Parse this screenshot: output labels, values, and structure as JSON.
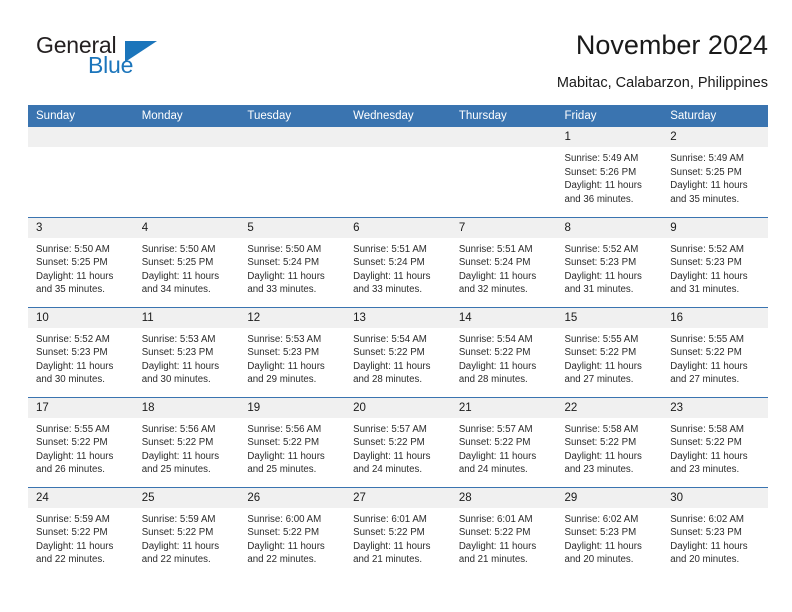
{
  "brand": {
    "name_top": "General",
    "name_bottom": "Blue",
    "triangle_icon": "blue-triangle-logo-mark",
    "color_top": "#231f20",
    "color_bottom": "#1b75bb"
  },
  "header": {
    "title": "November 2024",
    "subtitle": "Mabitac, Calabarzon, Philippines"
  },
  "theme": {
    "header_blue": "#3a74b0",
    "daynum_band": "#f0f0f0",
    "text": "#2b2b2b"
  },
  "weekday_headers": [
    "Sunday",
    "Monday",
    "Tuesday",
    "Wednesday",
    "Thursday",
    "Friday",
    "Saturday"
  ],
  "labels": {
    "sunrise_prefix": "Sunrise:",
    "sunset_prefix": "Sunset:",
    "daylight_prefix": "Daylight:"
  },
  "weeks": [
    [
      {
        "day": "",
        "empty": true
      },
      {
        "day": "",
        "empty": true
      },
      {
        "day": "",
        "empty": true
      },
      {
        "day": "",
        "empty": true
      },
      {
        "day": "",
        "empty": true
      },
      {
        "day": "1",
        "sunrise": "Sunrise: 5:49 AM",
        "sunset": "Sunset: 5:26 PM",
        "daylight_1": "Daylight: 11 hours",
        "daylight_2": "and 36 minutes."
      },
      {
        "day": "2",
        "sunrise": "Sunrise: 5:49 AM",
        "sunset": "Sunset: 5:25 PM",
        "daylight_1": "Daylight: 11 hours",
        "daylight_2": "and 35 minutes."
      }
    ],
    [
      {
        "day": "3",
        "sunrise": "Sunrise: 5:50 AM",
        "sunset": "Sunset: 5:25 PM",
        "daylight_1": "Daylight: 11 hours",
        "daylight_2": "and 35 minutes."
      },
      {
        "day": "4",
        "sunrise": "Sunrise: 5:50 AM",
        "sunset": "Sunset: 5:25 PM",
        "daylight_1": "Daylight: 11 hours",
        "daylight_2": "and 34 minutes."
      },
      {
        "day": "5",
        "sunrise": "Sunrise: 5:50 AM",
        "sunset": "Sunset: 5:24 PM",
        "daylight_1": "Daylight: 11 hours",
        "daylight_2": "and 33 minutes."
      },
      {
        "day": "6",
        "sunrise": "Sunrise: 5:51 AM",
        "sunset": "Sunset: 5:24 PM",
        "daylight_1": "Daylight: 11 hours",
        "daylight_2": "and 33 minutes."
      },
      {
        "day": "7",
        "sunrise": "Sunrise: 5:51 AM",
        "sunset": "Sunset: 5:24 PM",
        "daylight_1": "Daylight: 11 hours",
        "daylight_2": "and 32 minutes."
      },
      {
        "day": "8",
        "sunrise": "Sunrise: 5:52 AM",
        "sunset": "Sunset: 5:23 PM",
        "daylight_1": "Daylight: 11 hours",
        "daylight_2": "and 31 minutes."
      },
      {
        "day": "9",
        "sunrise": "Sunrise: 5:52 AM",
        "sunset": "Sunset: 5:23 PM",
        "daylight_1": "Daylight: 11 hours",
        "daylight_2": "and 31 minutes."
      }
    ],
    [
      {
        "day": "10",
        "sunrise": "Sunrise: 5:52 AM",
        "sunset": "Sunset: 5:23 PM",
        "daylight_1": "Daylight: 11 hours",
        "daylight_2": "and 30 minutes."
      },
      {
        "day": "11",
        "sunrise": "Sunrise: 5:53 AM",
        "sunset": "Sunset: 5:23 PM",
        "daylight_1": "Daylight: 11 hours",
        "daylight_2": "and 30 minutes."
      },
      {
        "day": "12",
        "sunrise": "Sunrise: 5:53 AM",
        "sunset": "Sunset: 5:23 PM",
        "daylight_1": "Daylight: 11 hours",
        "daylight_2": "and 29 minutes."
      },
      {
        "day": "13",
        "sunrise": "Sunrise: 5:54 AM",
        "sunset": "Sunset: 5:22 PM",
        "daylight_1": "Daylight: 11 hours",
        "daylight_2": "and 28 minutes."
      },
      {
        "day": "14",
        "sunrise": "Sunrise: 5:54 AM",
        "sunset": "Sunset: 5:22 PM",
        "daylight_1": "Daylight: 11 hours",
        "daylight_2": "and 28 minutes."
      },
      {
        "day": "15",
        "sunrise": "Sunrise: 5:55 AM",
        "sunset": "Sunset: 5:22 PM",
        "daylight_1": "Daylight: 11 hours",
        "daylight_2": "and 27 minutes."
      },
      {
        "day": "16",
        "sunrise": "Sunrise: 5:55 AM",
        "sunset": "Sunset: 5:22 PM",
        "daylight_1": "Daylight: 11 hours",
        "daylight_2": "and 27 minutes."
      }
    ],
    [
      {
        "day": "17",
        "sunrise": "Sunrise: 5:55 AM",
        "sunset": "Sunset: 5:22 PM",
        "daylight_1": "Daylight: 11 hours",
        "daylight_2": "and 26 minutes."
      },
      {
        "day": "18",
        "sunrise": "Sunrise: 5:56 AM",
        "sunset": "Sunset: 5:22 PM",
        "daylight_1": "Daylight: 11 hours",
        "daylight_2": "and 25 minutes."
      },
      {
        "day": "19",
        "sunrise": "Sunrise: 5:56 AM",
        "sunset": "Sunset: 5:22 PM",
        "daylight_1": "Daylight: 11 hours",
        "daylight_2": "and 25 minutes."
      },
      {
        "day": "20",
        "sunrise": "Sunrise: 5:57 AM",
        "sunset": "Sunset: 5:22 PM",
        "daylight_1": "Daylight: 11 hours",
        "daylight_2": "and 24 minutes."
      },
      {
        "day": "21",
        "sunrise": "Sunrise: 5:57 AM",
        "sunset": "Sunset: 5:22 PM",
        "daylight_1": "Daylight: 11 hours",
        "daylight_2": "and 24 minutes."
      },
      {
        "day": "22",
        "sunrise": "Sunrise: 5:58 AM",
        "sunset": "Sunset: 5:22 PM",
        "daylight_1": "Daylight: 11 hours",
        "daylight_2": "and 23 minutes."
      },
      {
        "day": "23",
        "sunrise": "Sunrise: 5:58 AM",
        "sunset": "Sunset: 5:22 PM",
        "daylight_1": "Daylight: 11 hours",
        "daylight_2": "and 23 minutes."
      }
    ],
    [
      {
        "day": "24",
        "sunrise": "Sunrise: 5:59 AM",
        "sunset": "Sunset: 5:22 PM",
        "daylight_1": "Daylight: 11 hours",
        "daylight_2": "and 22 minutes."
      },
      {
        "day": "25",
        "sunrise": "Sunrise: 5:59 AM",
        "sunset": "Sunset: 5:22 PM",
        "daylight_1": "Daylight: 11 hours",
        "daylight_2": "and 22 minutes."
      },
      {
        "day": "26",
        "sunrise": "Sunrise: 6:00 AM",
        "sunset": "Sunset: 5:22 PM",
        "daylight_1": "Daylight: 11 hours",
        "daylight_2": "and 22 minutes."
      },
      {
        "day": "27",
        "sunrise": "Sunrise: 6:01 AM",
        "sunset": "Sunset: 5:22 PM",
        "daylight_1": "Daylight: 11 hours",
        "daylight_2": "and 21 minutes."
      },
      {
        "day": "28",
        "sunrise": "Sunrise: 6:01 AM",
        "sunset": "Sunset: 5:22 PM",
        "daylight_1": "Daylight: 11 hours",
        "daylight_2": "and 21 minutes."
      },
      {
        "day": "29",
        "sunrise": "Sunrise: 6:02 AM",
        "sunset": "Sunset: 5:23 PM",
        "daylight_1": "Daylight: 11 hours",
        "daylight_2": "and 20 minutes."
      },
      {
        "day": "30",
        "sunrise": "Sunrise: 6:02 AM",
        "sunset": "Sunset: 5:23 PM",
        "daylight_1": "Daylight: 11 hours",
        "daylight_2": "and 20 minutes."
      }
    ]
  ]
}
